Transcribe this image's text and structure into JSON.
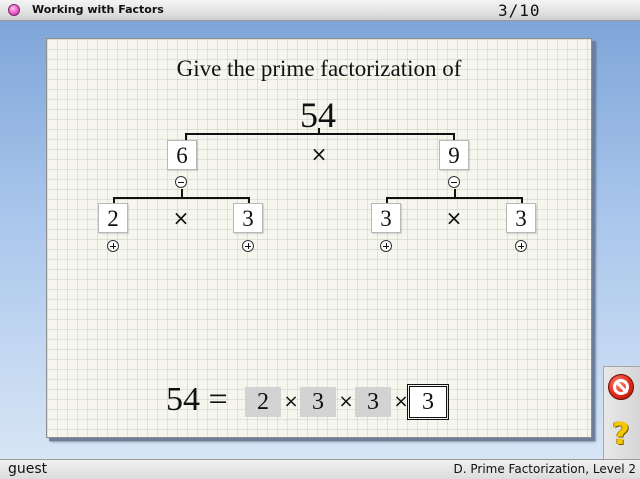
{
  "window": {
    "title": "Working with Factors",
    "progress": "3/10"
  },
  "problem": {
    "prompt": "Give the prime factorization of",
    "number": "54"
  },
  "tree": {
    "times": "×",
    "left": {
      "value": "6",
      "toggle": "minus"
    },
    "right": {
      "value": "9",
      "toggle": "minus"
    },
    "left_children": [
      {
        "value": "2",
        "toggle": "plus"
      },
      {
        "value": "3",
        "toggle": "plus"
      }
    ],
    "right_children": [
      {
        "value": "3",
        "toggle": "plus"
      },
      {
        "value": "3",
        "toggle": "plus"
      }
    ]
  },
  "answer": {
    "lhs": "54 =",
    "times": "×",
    "factors": [
      "2",
      "3",
      "3",
      "3"
    ],
    "active_index": 3
  },
  "toolbar": {
    "stop_icon": "stop-icon",
    "help_icon": "help-icon",
    "help_glyph": "?"
  },
  "status": {
    "user": "guest",
    "level": "D. Prime Factorization, Level 2"
  },
  "colors": {
    "accent_pink": "#ee5ac6",
    "panel_bg": "#f6f6ee",
    "stop_red": "#e02a1a",
    "help_yellow": "#f2c800"
  }
}
